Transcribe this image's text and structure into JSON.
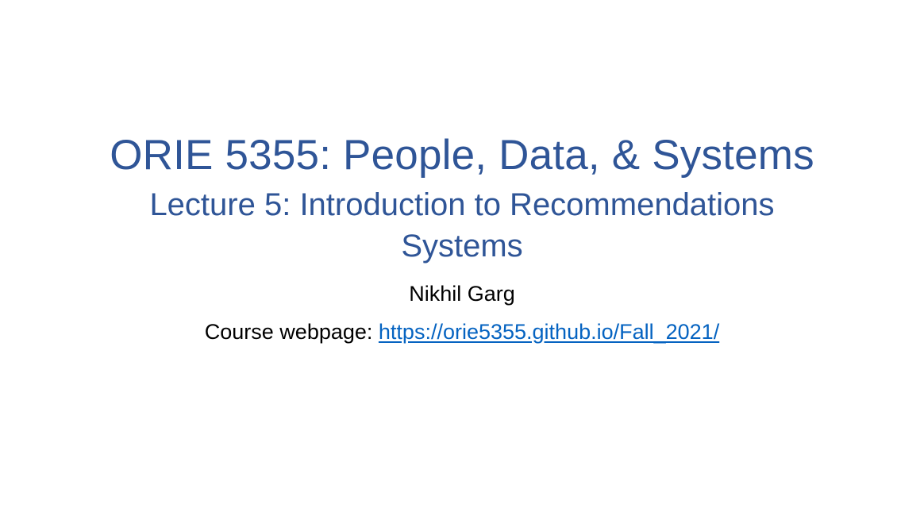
{
  "slide": {
    "title": "ORIE 5355: People, Data, & Systems",
    "subtitle": "Lecture 5: Introduction to Recommendations Systems",
    "author": "Nikhil Garg",
    "course_label": "Course webpage: ",
    "course_url_text": "https://orie5355.github.io/Fall_2021/"
  },
  "colors": {
    "title": "#2f5597",
    "body_text": "#000000",
    "link": "#0563c1",
    "background": "#ffffff"
  }
}
